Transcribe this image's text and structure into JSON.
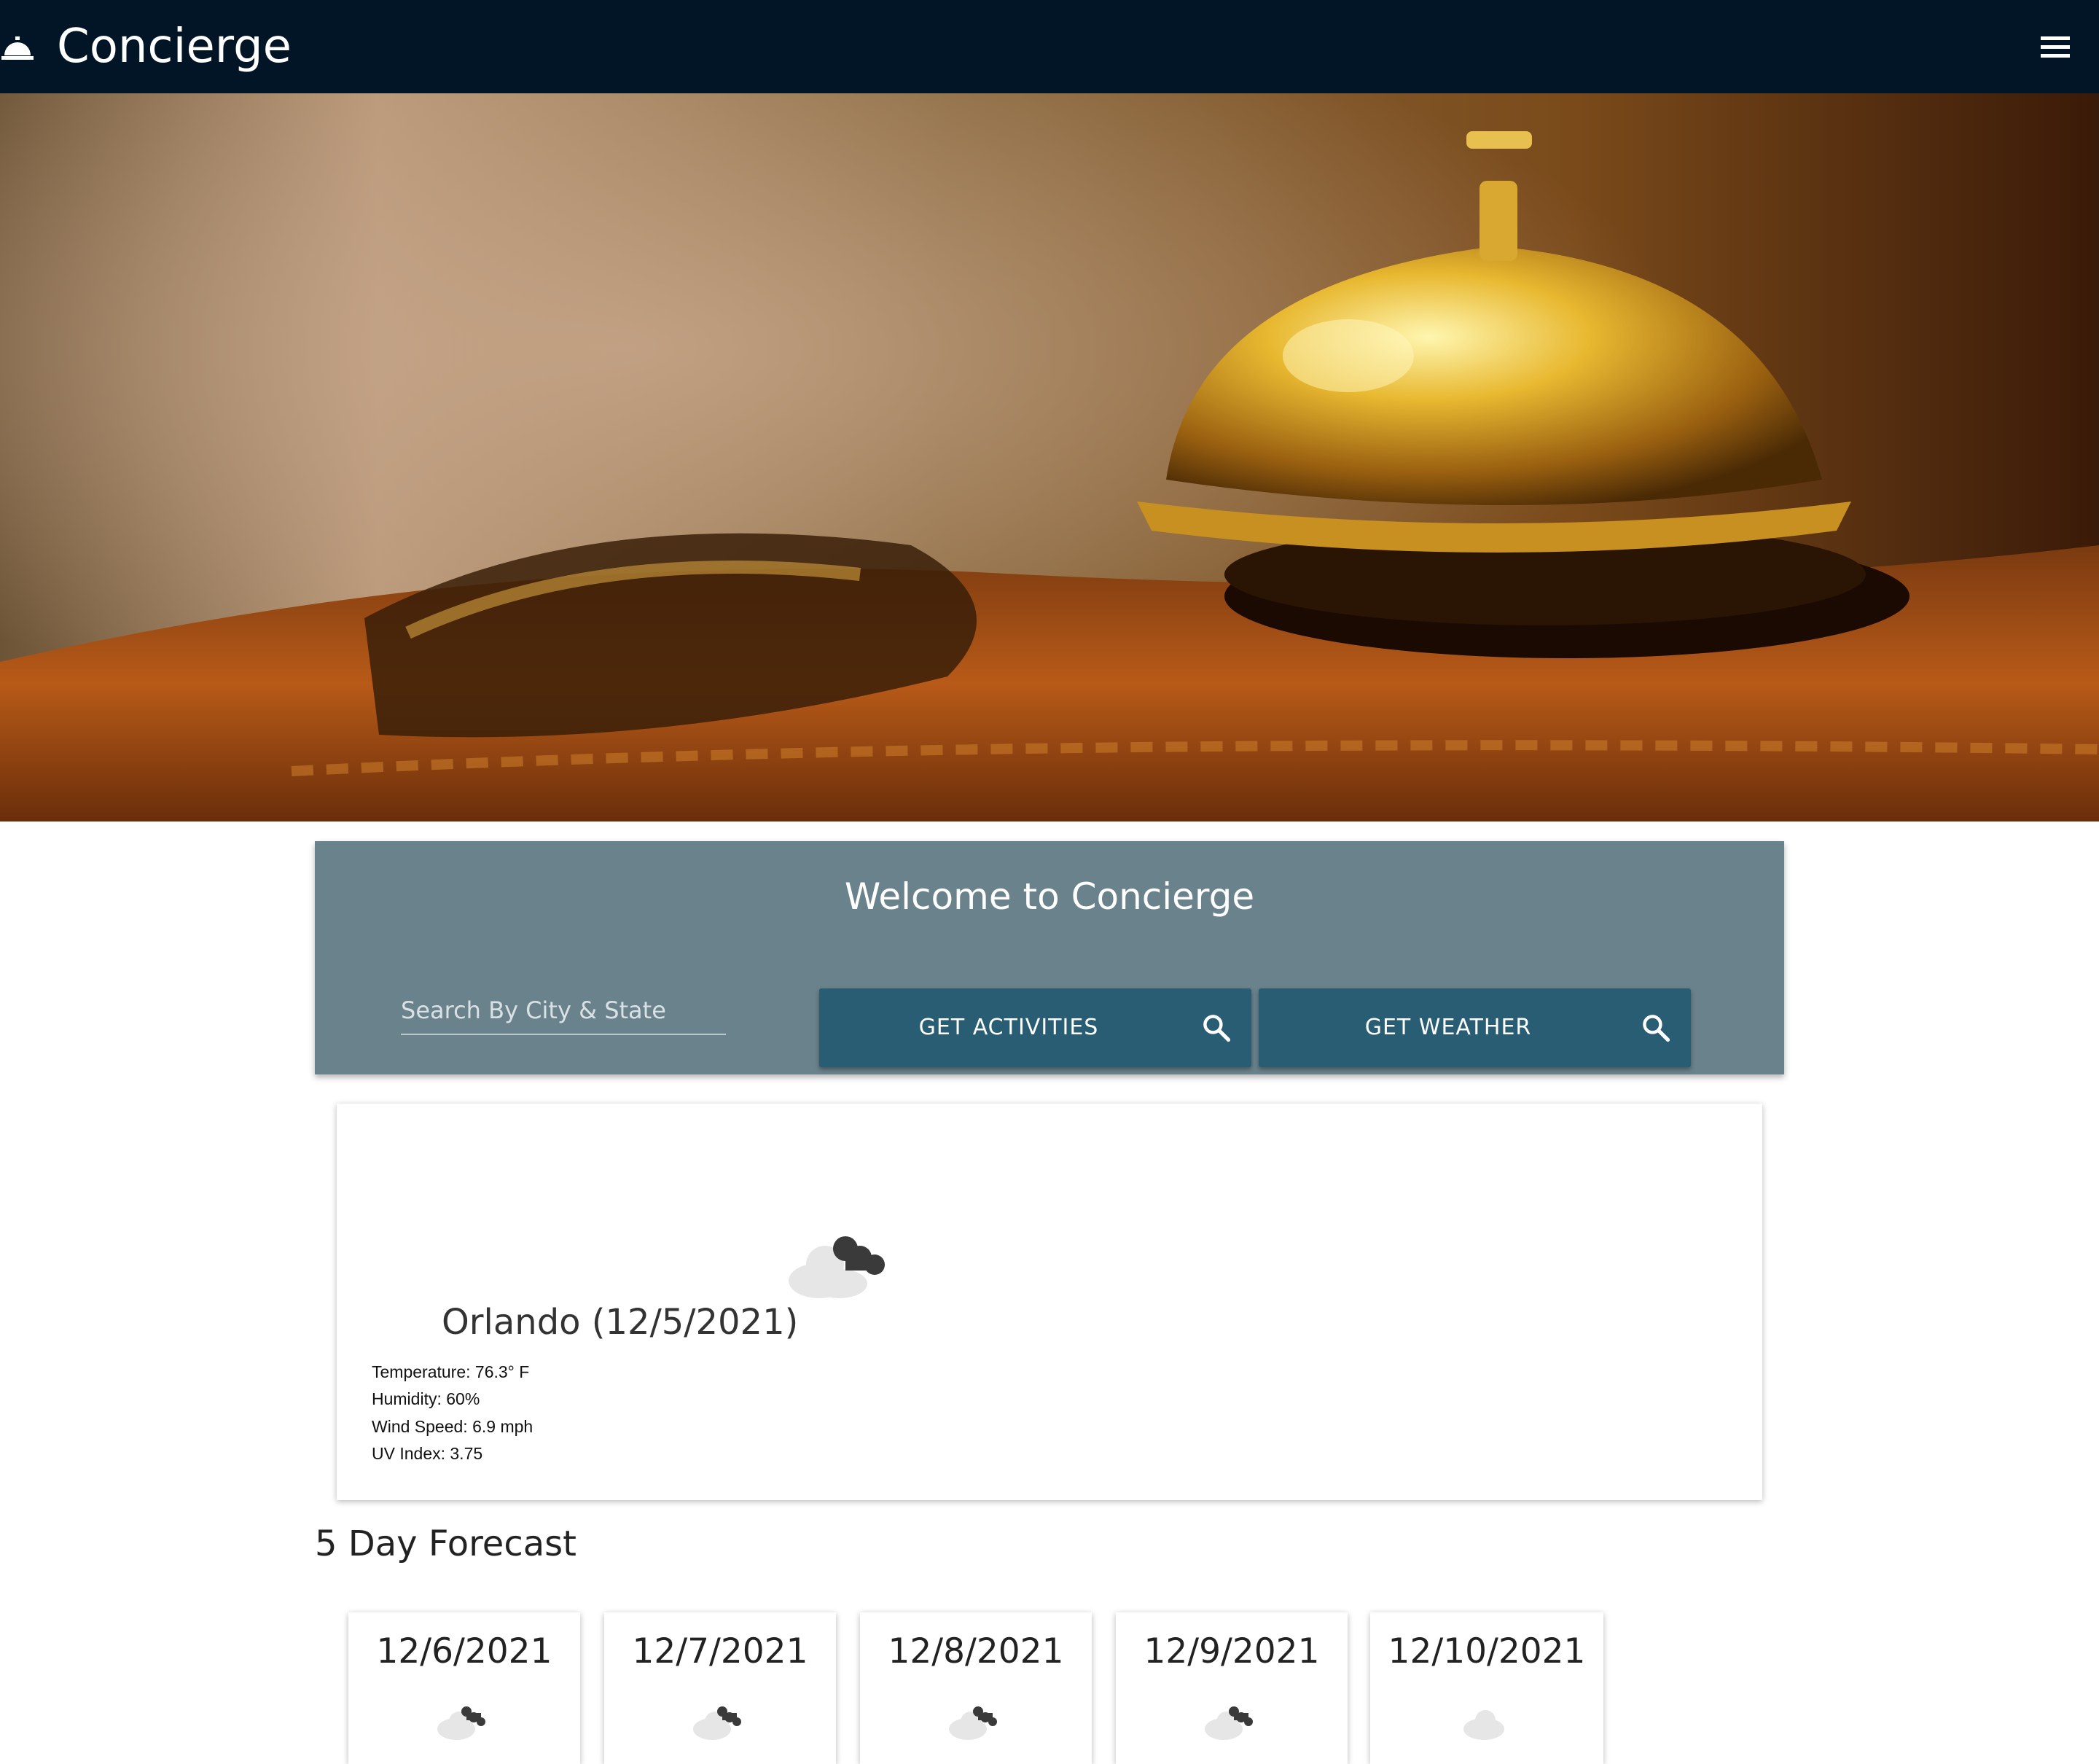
{
  "navbar": {
    "title": "Concierge",
    "brand_icon": "concierge-bell-icon",
    "menu_icon": "hamburger-menu-icon",
    "background": "#021526"
  },
  "search_panel": {
    "heading": "Welcome to Concierge",
    "search_placeholder": "Search By City & State",
    "search_value": "",
    "activities_button": "GET ACTIVITIES",
    "weather_button": "GET WEATHER",
    "button_icon": "search-icon",
    "background": "#6a828b",
    "button_color": "#285d73"
  },
  "current_weather": {
    "title": "Orlando (12/5/2021)",
    "icon": "cloudy-icon",
    "temperature": "Temperature: 76.3° F",
    "humidity": "Humidity: 60%",
    "wind": "Wind Speed: 6.9 mph",
    "uv": "UV Index: 3.75"
  },
  "forecast": {
    "heading": "5 Day Forecast",
    "days": [
      {
        "date": "12/6/2021",
        "icon": "broken-clouds-icon"
      },
      {
        "date": "12/7/2021",
        "icon": "broken-clouds-icon"
      },
      {
        "date": "12/8/2021",
        "icon": "broken-clouds-icon"
      },
      {
        "date": "12/9/2021",
        "icon": "broken-clouds-icon"
      },
      {
        "date": "12/10/2021",
        "icon": "light-cloud-icon"
      }
    ]
  }
}
